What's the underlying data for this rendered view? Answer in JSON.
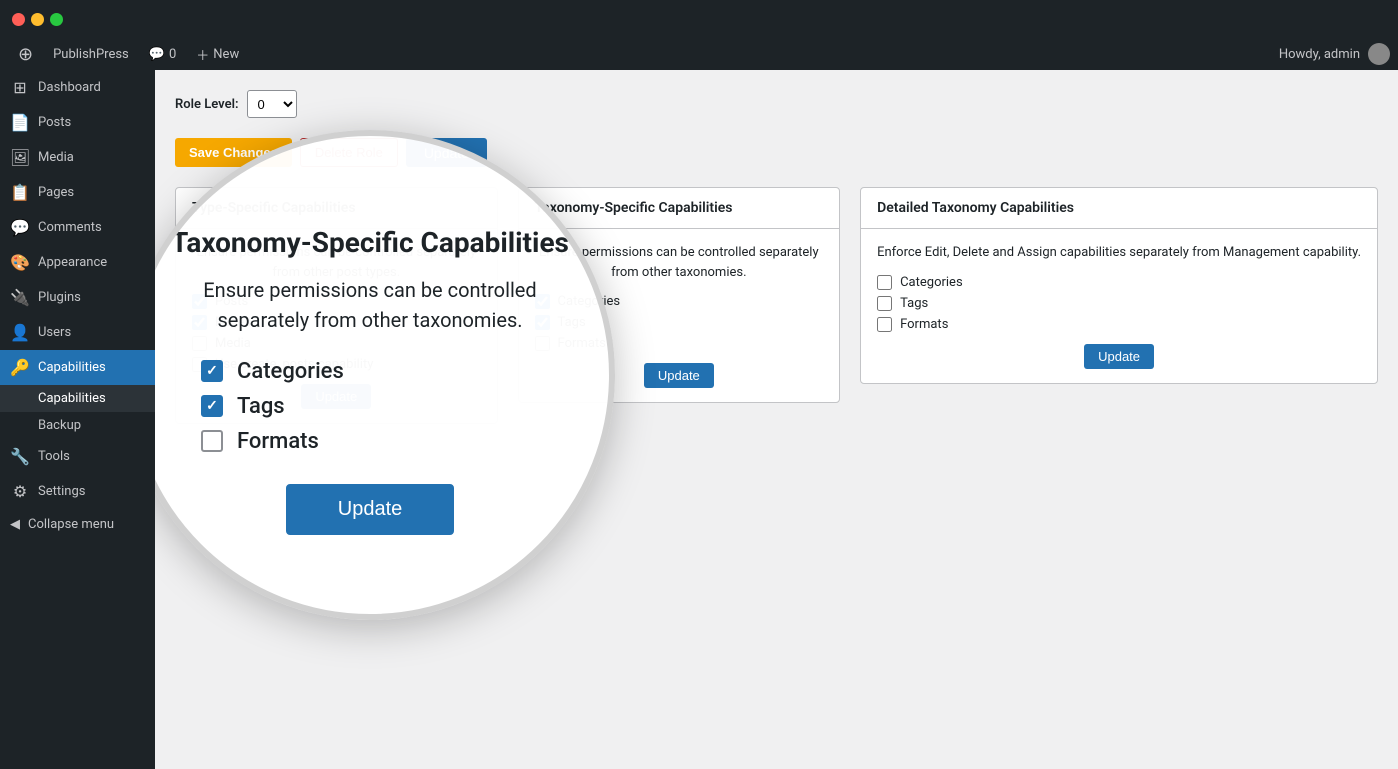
{
  "titlebar": {
    "traffic": [
      "red",
      "yellow",
      "green"
    ]
  },
  "adminbar": {
    "wp_icon": "⊕",
    "site_name": "PublishPress",
    "comments_count": "0",
    "new_label": "New",
    "howdy_text": "Howdy, admin"
  },
  "sidebar": {
    "items": [
      {
        "id": "dashboard",
        "icon": "⊞",
        "label": "Dashboard"
      },
      {
        "id": "posts",
        "icon": "📄",
        "label": "Posts"
      },
      {
        "id": "media",
        "icon": "🖼",
        "label": "Media"
      },
      {
        "id": "pages",
        "icon": "📋",
        "label": "Pages"
      },
      {
        "id": "comments",
        "icon": "💬",
        "label": "Comments"
      },
      {
        "id": "appearance",
        "icon": "🎨",
        "label": "Appearance"
      },
      {
        "id": "plugins",
        "icon": "🔌",
        "label": "Plugins"
      },
      {
        "id": "users",
        "icon": "👤",
        "label": "Users"
      },
      {
        "id": "capabilities",
        "icon": "🔑",
        "label": "Capabilities",
        "active": true
      },
      {
        "id": "tools",
        "icon": "🔧",
        "label": "Tools"
      },
      {
        "id": "settings",
        "icon": "⚙",
        "label": "Settings"
      }
    ],
    "sub_items": [
      {
        "id": "capabilities-sub",
        "label": "Capabilities",
        "active": true
      },
      {
        "id": "backup-sub",
        "label": "Backup"
      }
    ],
    "collapse_label": "Collapse menu"
  },
  "content": {
    "role_level_label": "Role Level:",
    "role_level_value": "0",
    "save_changes_label": "Save Changes",
    "delete_role_label": "Delete Role",
    "update_label": "Update"
  },
  "type_specific_card": {
    "title": "Type-Specific Capabilities",
    "description": "Ensure permissions can be controlled separately from other post types.",
    "checkboxes": [
      {
        "label": "Posts",
        "checked": true
      },
      {
        "label": "Pages",
        "checked": true
      },
      {
        "label": "Media",
        "checked": false
      }
    ],
    "use_create_posts": {
      "label": "Use create_posts capability",
      "checked": false
    },
    "update_label": "Update"
  },
  "taxonomy_specific_card": {
    "title": "Taxonomy-Specific Capabilities",
    "description": "Ensure permissions can be controlled separately from other taxonomies.",
    "checkboxes": [
      {
        "label": "Categories",
        "checked": true
      },
      {
        "label": "Tags",
        "checked": true
      },
      {
        "label": "Formats",
        "checked": false
      }
    ],
    "update_label": "Update"
  },
  "detailed_taxonomy_card": {
    "title": "Detailed Taxonomy Capabilities",
    "description": "Enforce Edit, Delete and Assign capabilities separately from Management capability.",
    "checkboxes": [
      {
        "label": "Categories",
        "checked": false
      },
      {
        "label": "Tags",
        "checked": false
      },
      {
        "label": "Formats",
        "checked": false
      }
    ],
    "update_label": "Update"
  },
  "magnify": {
    "title": "Taxonomy-Specific Capabilities",
    "description": "Ensure permissions can be controlled separately from other taxonomies.",
    "checkboxes": [
      {
        "label": "Categories",
        "checked": true
      },
      {
        "label": "Tags",
        "checked": true
      },
      {
        "label": "Formats",
        "checked": false
      }
    ],
    "update_label": "Update"
  },
  "colors": {
    "save_btn_bg": "#f6a800",
    "update_btn_bg": "#2271b1",
    "sidebar_bg": "#1d2327",
    "sidebar_active_bg": "#2271b1"
  }
}
